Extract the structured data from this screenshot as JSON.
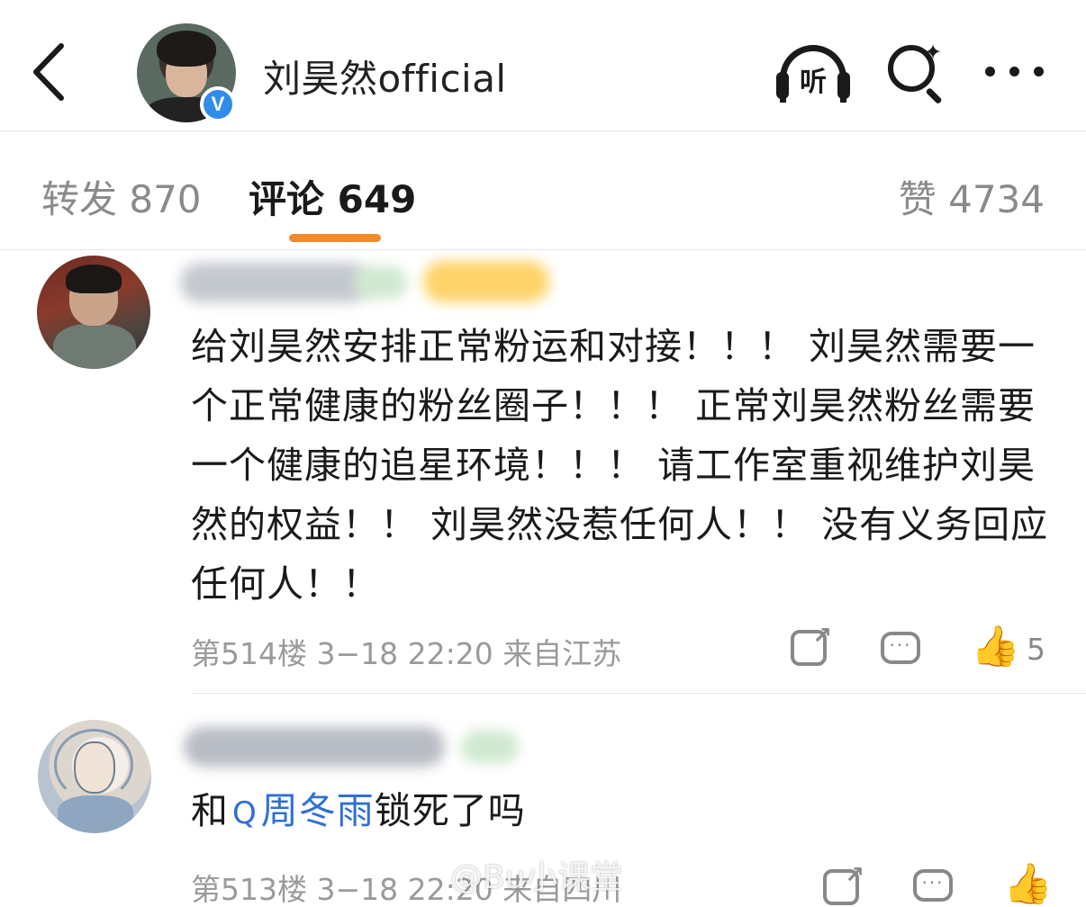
{
  "header": {
    "account_name": "刘昊然official",
    "verified_badge": "V",
    "listen_label": "听",
    "icons": [
      "back-arrow-icon",
      "listen-headphones-icon",
      "search-icon",
      "more-dots-icon"
    ]
  },
  "tabs": {
    "repost": "转发 870",
    "comment": "评论 649",
    "like": "赞 4734",
    "accent_color": "#f28a2a"
  },
  "comments": [
    {
      "text": "给刘昊然安排正常粉运和对接！！！ 刘昊然需要一个正常健康的粉丝圈子！！！ 正常刘昊然粉丝需要一个健康的追星环境！！！ 请工作室重视维护刘昊然的权益！！ 刘昊然没惹任何人！！ 没有义务回应任何人！！",
      "meta": "第514楼 3−18 22:20 来自江苏",
      "likes": "5"
    },
    {
      "text_prefix": "和",
      "mention": "周冬雨",
      "text_suffix": "锁死了吗",
      "meta": "第513楼 3−18 22:20 来自四川"
    }
  ],
  "watermark": "@Bu小课堂",
  "colors": {
    "mention": "#2f6fd6",
    "verified": "#2f8ce8"
  }
}
